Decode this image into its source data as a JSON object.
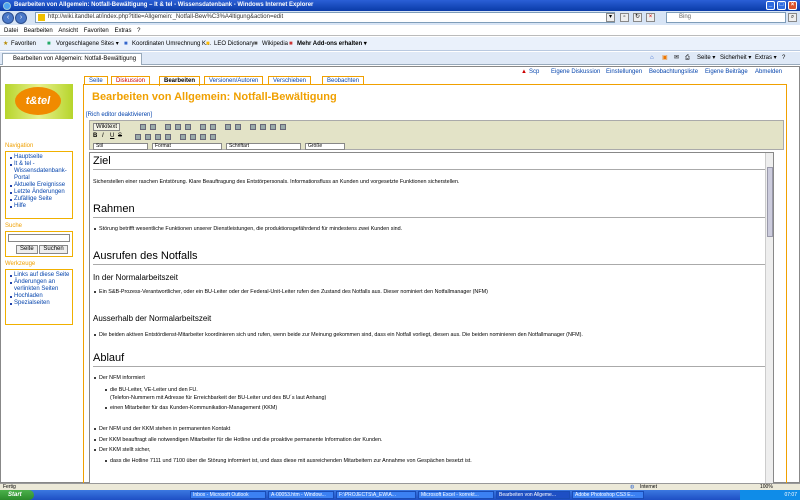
{
  "window": {
    "title": "Bearbeiten von Allgemein: Notfall-Bewältigung – It & tel - Wissensdatenbank - Windows Internet Explorer"
  },
  "address": {
    "url": "http://wiki.itandtel.at/index.php?title=Allgemein:_Notfall-Bew%C3%A4ltigung&action=edit"
  },
  "search": {
    "placeholder": "Bing"
  },
  "menu": [
    "Datei",
    "Bearbeiten",
    "Ansicht",
    "Favoriten",
    "Extras",
    "?"
  ],
  "favorites": {
    "label": "Favoriten",
    "items": [
      "Vorgeschlagene Sites ▾",
      "Koordinaten Umrechnung K...",
      "LEO Dictionary",
      "Wikipedia",
      "Mehr Add-ons erhalten ▾"
    ]
  },
  "tab": {
    "label": "Bearbeiten von Allgemein: Notfall-Bewältigung – It & t..."
  },
  "tab_tools": [
    "Seite ▾",
    "Sicherheit ▾",
    "Extras ▾",
    "?"
  ],
  "user_links": [
    "Scp",
    "Eigene Diskussion",
    "Einstellungen",
    "Beobachtungsliste",
    "Eigene Beiträge",
    "Abmelden"
  ],
  "page_tabs": [
    "Seite",
    "Diskussion",
    "Bearbeiten",
    "Versionen/Autoren",
    "Verschieben",
    "Beobachten"
  ],
  "logo_text": "t&tel",
  "navigation": {
    "title": "Navigation",
    "items": [
      "Hauptseite",
      "It & tel - Wissensdatenbank-Portal",
      "Aktuelle Ereignisse",
      "Letzte Änderungen",
      "Zufällige Seite",
      "Hilfe"
    ]
  },
  "search_box": {
    "title": "Suche",
    "go": "Seite",
    "search": "Suchen"
  },
  "tools": {
    "title": "Werkzeuge",
    "items": [
      "Links auf diese Seite",
      "Änderungen an verlinkten Seiten",
      "Hochladen",
      "Spezialseiten"
    ]
  },
  "page_title": "Bearbeiten von Allgemein: Notfall-Bewältigung",
  "rich_editor_link": "[Rich editor deaktivieren]",
  "editor_toolbar": {
    "source": "Wikitext",
    "style": "Stil",
    "format": "Format",
    "font": "Schriftart",
    "size": "Größe"
  },
  "content": {
    "h_ziel": "Ziel",
    "p_ziel": "Sicherstellen einer raschen Entstörung. Klare Beauftragung des Entstörpersonals. Informationsfluss an Kunden und vorgesetzte Funktionen sicherstellen.",
    "h_rahmen": "Rahmen",
    "li_rahmen": "Störung betrifft wesentliche Funktionen unserer Dienstleistungen, die produktionsgefährdend für mindestens zwei Kunden sind.",
    "h_ausrufen": "Ausrufen des Notfalls",
    "h_normal": "In der Normalarbeitszeit",
    "li_normal": "Ein S&B-Prozess-Verantwortlicher, oder ein BU-Leiter oder der Federal-Unit-Leiter rufen den Zustand des Notfalls aus. Dieser nominiert den Notfallmanager (NFM)",
    "h_ausser": "Ausserhalb der Normalarbeitszeit",
    "li_ausser": "Die beiden aktiven Entstördienst-Mitarbeiter koordinieren sich und rufen, wenn beide zur Meinung gekommen sind, dass ein Notfall vorliegt, diesen aus. Die beiden nominieren den Notfallmanager (NFM).",
    "h_ablauf": "Ablauf",
    "li_nfm": "Der NFM informiert",
    "li_bu": "die BU-Leiter, VE-Leiter und den FU.",
    "plain_tel": "(Telefon-Nummern mit Adresse für Erreichbarkeit der BU-Leiter und des BU´s laut Anhang)",
    "li_kkm": "einen Mitarbeiter für das Kunden-Kommunikation-Management (KKM)",
    "li_kontakt": "Der NFM und der KKM stehen in permanenten Kontakt",
    "li_beauftragt": "Der KKM beauftragt alle notwendigen Mitarbeiter für die Hotline und die proaktive permanente Information der Kunden.",
    "li_sicher": "Der KKM stellt sicher,",
    "li_hotline": "dass die Hotline 7111 und 7100 über die Störung informiert ist, und dass diese mit ausreichenden Mitarbeitern zur Annahme von Gespächen besetzt ist."
  },
  "status": {
    "left": "Fertig",
    "zone": "Internet",
    "zoom": "100%"
  },
  "taskbar": {
    "start": "Start",
    "tasks": [
      "Inbox - Microsoft Outlook",
      "A-00053.htm - Window...",
      "F:\\PROJECTS\\A_EW\\A...",
      "Microsoft Excel - korrekt...",
      "Bearbeiten von Allgeme...",
      "Adobe Photoshop CS3 E..."
    ],
    "clock": "07:07"
  }
}
